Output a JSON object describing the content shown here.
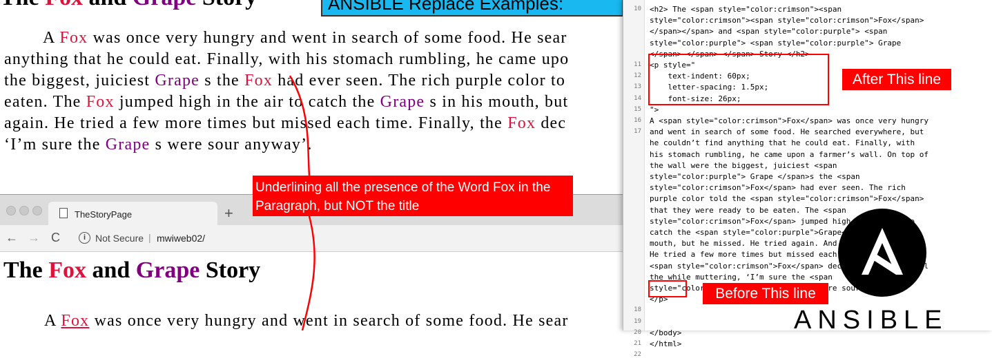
{
  "banner": {
    "text": "ANSIBLE Replace Examples:"
  },
  "top_story": {
    "title_parts": [
      "The ",
      "Fox",
      " and ",
      "Grape",
      " Story"
    ],
    "lines": [
      [
        "A ",
        "Fox",
        " was once very hungry and went in search of some food. He sear"
      ],
      [
        "anything that he could eat. Finally, with his stomach rumbling, he came upo"
      ],
      [
        "the biggest, juiciest ",
        "Grape",
        " s the ",
        "Fox",
        " had ever seen. The rich purple color to"
      ],
      [
        "eaten. The ",
        "Fox",
        " jumped high in the air to catch the ",
        "Grape",
        " s in his mouth, but"
      ],
      [
        "again. He tried a few more times but missed each time. Finally, the ",
        "Fox",
        " dec"
      ],
      [
        "‘I’m sure the ",
        "Grape",
        " s were sour anyway’."
      ]
    ]
  },
  "annotations": {
    "underline_note": "Underlining all the presence of the Word Fox in the Paragraph, but NOT the title",
    "after_note": "After This line",
    "before_note": "Before This line"
  },
  "browser": {
    "tab_title": "TheStoryPage",
    "new_tab": "+",
    "not_secure": "Not Secure",
    "url": "mwiweb02/",
    "back": "←",
    "forward": "→",
    "reload": "C",
    "info": "i",
    "heading_parts": [
      "The ",
      "Fox",
      " and ",
      "Grape",
      " Story"
    ],
    "para_parts": [
      "A ",
      "Fox",
      " was once very hungry and went in search of some food. He sear"
    ]
  },
  "editor": {
    "line_numbers": [
      "10",
      "11",
      "12",
      "13",
      "14",
      "15",
      "16",
      "17",
      "18",
      "19",
      "20",
      "21",
      "22"
    ],
    "code_lines": [
      "<h2> The <span style=\"color:crimson\"><span",
      "style=\"color:crimson\"><span style=\"color:crimson\">Fox</span>",
      "</span></span> and <span style=\"color:purple\"> <span",
      "style=\"color:purple\"> <span style=\"color:purple\"> Grape",
      "</span> </span> </span> Story </h2>",
      "<p style=\"",
      "    text-indent: 60px;",
      "    letter-spacing: 1.5px;",
      "    font-size: 26px;",
      "\">",
      "A <span style=\"color:crimson\">Fox</span> was once very hungry",
      "and went in search of some food. He searched everywhere, but",
      "he couldn’t find anything that he could eat. Finally, with",
      "his stomach rumbling, he came upon a farmer’s wall. On top of",
      "the wall were the biggest, juiciest <span",
      "style=\"color:purple\"> Grape </span>s the <span",
      "style=\"color:crimson\">Fox</span> had ever seen. The rich",
      "purple color told the <span style=\"color:crimson\">Fox</span>",
      "that they were ready to be eaten. The <span",
      "style=\"color:crimson\">Fox</span> jumped high in the air to",
      "catch the <span style=\"color:purple\">Grape</span>s in his",
      "mouth, but he missed. He tried again. And again.",
      "He tried a few more times but missed each time. Finally, the",
      "<span style=\"color:crimson\">Fox</span> decided to go home all",
      "the while muttering, ‘I’m sure the <span",
      "style=\"color:purple\"> Grape </span>s were sour anyway’.",
      "</p>",
      "",
      "",
      "</body>",
      "</html>"
    ]
  },
  "logo": {
    "wordmark": "ANSIBLE",
    "glyph": "A"
  },
  "colors": {
    "fox": "#dc143c",
    "grape": "#800080",
    "annotation_red": "#ff0000",
    "banner": "#1ab8f0"
  }
}
